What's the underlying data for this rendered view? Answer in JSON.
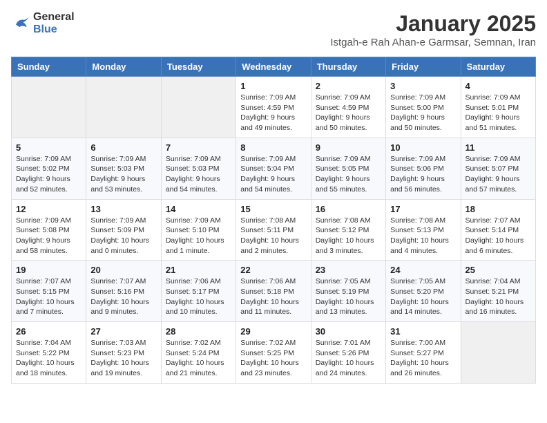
{
  "logo": {
    "line1": "General",
    "line2": "Blue"
  },
  "title": "January 2025",
  "subtitle": "Istgah-e Rah Ahan-e Garmsar, Semnan, Iran",
  "headers": [
    "Sunday",
    "Monday",
    "Tuesday",
    "Wednesday",
    "Thursday",
    "Friday",
    "Saturday"
  ],
  "weeks": [
    [
      {
        "day": "",
        "info": ""
      },
      {
        "day": "",
        "info": ""
      },
      {
        "day": "",
        "info": ""
      },
      {
        "day": "1",
        "info": "Sunrise: 7:09 AM\nSunset: 4:59 PM\nDaylight: 9 hours\nand 49 minutes."
      },
      {
        "day": "2",
        "info": "Sunrise: 7:09 AM\nSunset: 4:59 PM\nDaylight: 9 hours\nand 50 minutes."
      },
      {
        "day": "3",
        "info": "Sunrise: 7:09 AM\nSunset: 5:00 PM\nDaylight: 9 hours\nand 50 minutes."
      },
      {
        "day": "4",
        "info": "Sunrise: 7:09 AM\nSunset: 5:01 PM\nDaylight: 9 hours\nand 51 minutes."
      }
    ],
    [
      {
        "day": "5",
        "info": "Sunrise: 7:09 AM\nSunset: 5:02 PM\nDaylight: 9 hours\nand 52 minutes."
      },
      {
        "day": "6",
        "info": "Sunrise: 7:09 AM\nSunset: 5:03 PM\nDaylight: 9 hours\nand 53 minutes."
      },
      {
        "day": "7",
        "info": "Sunrise: 7:09 AM\nSunset: 5:03 PM\nDaylight: 9 hours\nand 54 minutes."
      },
      {
        "day": "8",
        "info": "Sunrise: 7:09 AM\nSunset: 5:04 PM\nDaylight: 9 hours\nand 54 minutes."
      },
      {
        "day": "9",
        "info": "Sunrise: 7:09 AM\nSunset: 5:05 PM\nDaylight: 9 hours\nand 55 minutes."
      },
      {
        "day": "10",
        "info": "Sunrise: 7:09 AM\nSunset: 5:06 PM\nDaylight: 9 hours\nand 56 minutes."
      },
      {
        "day": "11",
        "info": "Sunrise: 7:09 AM\nSunset: 5:07 PM\nDaylight: 9 hours\nand 57 minutes."
      }
    ],
    [
      {
        "day": "12",
        "info": "Sunrise: 7:09 AM\nSunset: 5:08 PM\nDaylight: 9 hours\nand 58 minutes."
      },
      {
        "day": "13",
        "info": "Sunrise: 7:09 AM\nSunset: 5:09 PM\nDaylight: 10 hours\nand 0 minutes."
      },
      {
        "day": "14",
        "info": "Sunrise: 7:09 AM\nSunset: 5:10 PM\nDaylight: 10 hours\nand 1 minute."
      },
      {
        "day": "15",
        "info": "Sunrise: 7:08 AM\nSunset: 5:11 PM\nDaylight: 10 hours\nand 2 minutes."
      },
      {
        "day": "16",
        "info": "Sunrise: 7:08 AM\nSunset: 5:12 PM\nDaylight: 10 hours\nand 3 minutes."
      },
      {
        "day": "17",
        "info": "Sunrise: 7:08 AM\nSunset: 5:13 PM\nDaylight: 10 hours\nand 4 minutes."
      },
      {
        "day": "18",
        "info": "Sunrise: 7:07 AM\nSunset: 5:14 PM\nDaylight: 10 hours\nand 6 minutes."
      }
    ],
    [
      {
        "day": "19",
        "info": "Sunrise: 7:07 AM\nSunset: 5:15 PM\nDaylight: 10 hours\nand 7 minutes."
      },
      {
        "day": "20",
        "info": "Sunrise: 7:07 AM\nSunset: 5:16 PM\nDaylight: 10 hours\nand 9 minutes."
      },
      {
        "day": "21",
        "info": "Sunrise: 7:06 AM\nSunset: 5:17 PM\nDaylight: 10 hours\nand 10 minutes."
      },
      {
        "day": "22",
        "info": "Sunrise: 7:06 AM\nSunset: 5:18 PM\nDaylight: 10 hours\nand 11 minutes."
      },
      {
        "day": "23",
        "info": "Sunrise: 7:05 AM\nSunset: 5:19 PM\nDaylight: 10 hours\nand 13 minutes."
      },
      {
        "day": "24",
        "info": "Sunrise: 7:05 AM\nSunset: 5:20 PM\nDaylight: 10 hours\nand 14 minutes."
      },
      {
        "day": "25",
        "info": "Sunrise: 7:04 AM\nSunset: 5:21 PM\nDaylight: 10 hours\nand 16 minutes."
      }
    ],
    [
      {
        "day": "26",
        "info": "Sunrise: 7:04 AM\nSunset: 5:22 PM\nDaylight: 10 hours\nand 18 minutes."
      },
      {
        "day": "27",
        "info": "Sunrise: 7:03 AM\nSunset: 5:23 PM\nDaylight: 10 hours\nand 19 minutes."
      },
      {
        "day": "28",
        "info": "Sunrise: 7:02 AM\nSunset: 5:24 PM\nDaylight: 10 hours\nand 21 minutes."
      },
      {
        "day": "29",
        "info": "Sunrise: 7:02 AM\nSunset: 5:25 PM\nDaylight: 10 hours\nand 23 minutes."
      },
      {
        "day": "30",
        "info": "Sunrise: 7:01 AM\nSunset: 5:26 PM\nDaylight: 10 hours\nand 24 minutes."
      },
      {
        "day": "31",
        "info": "Sunrise: 7:00 AM\nSunset: 5:27 PM\nDaylight: 10 hours\nand 26 minutes."
      },
      {
        "day": "",
        "info": ""
      }
    ]
  ]
}
